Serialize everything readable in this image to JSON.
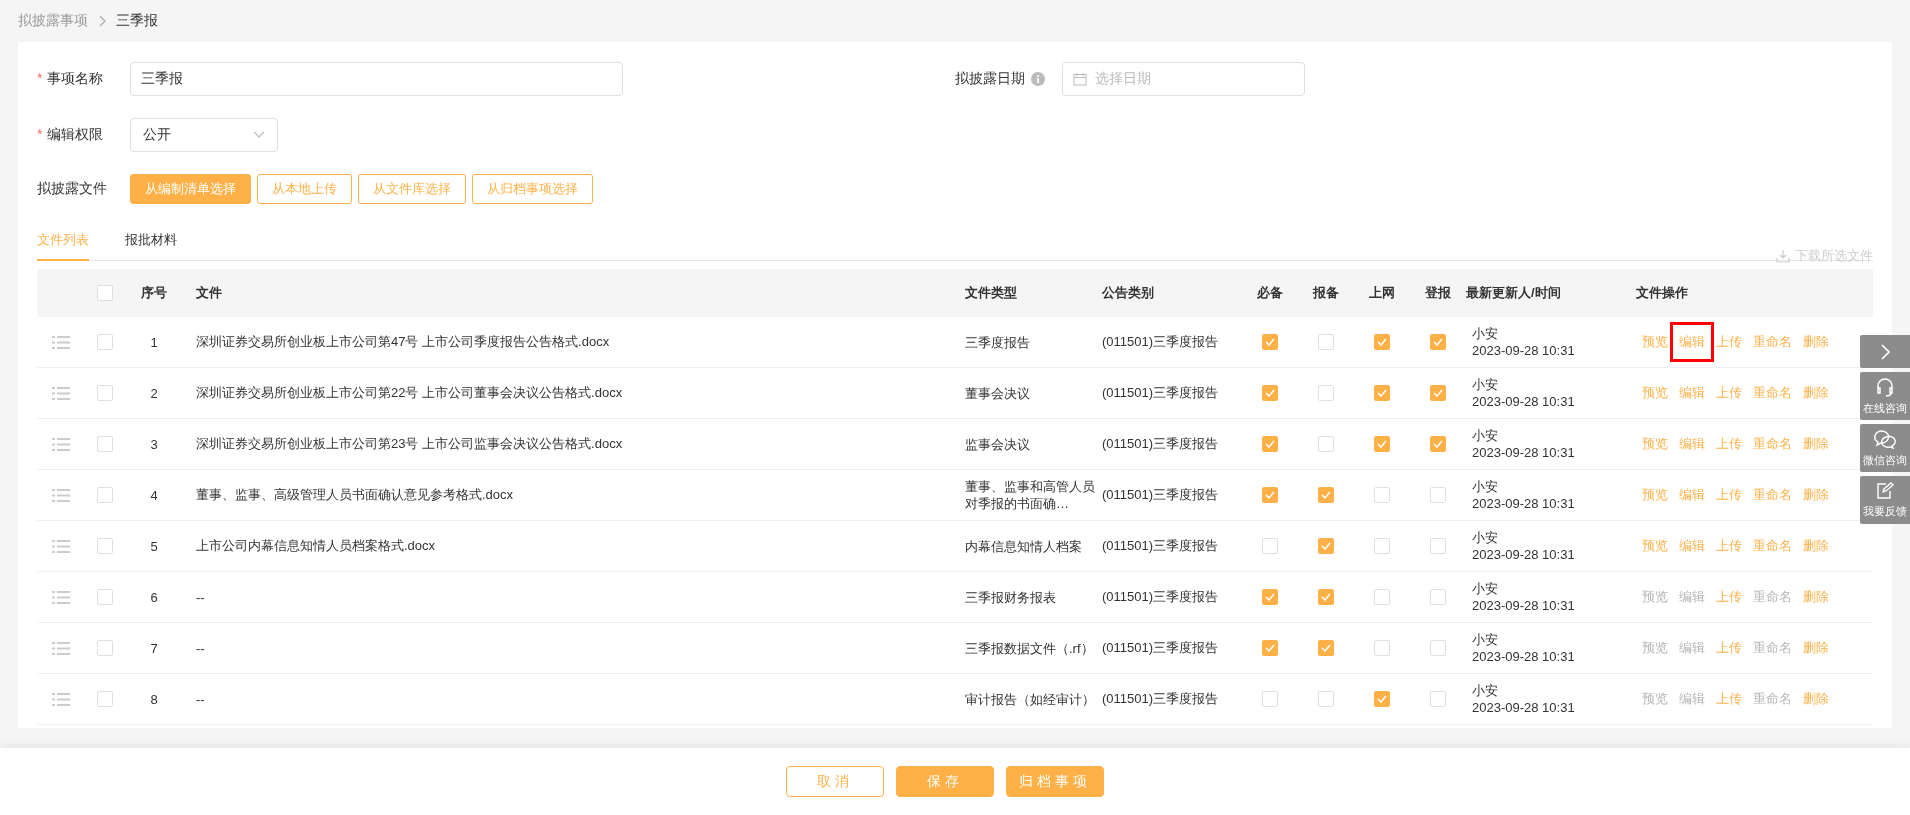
{
  "breadcrumb": [
    {
      "label": "拟披露事项"
    },
    {
      "label": "三季报"
    }
  ],
  "form": {
    "name_field": {
      "label": "事项名称",
      "required_mark": "*",
      "value": "三季报"
    },
    "date_field": {
      "label": "拟披露日期",
      "placeholder": "选择日期"
    },
    "permission_field": {
      "label": "编辑权限",
      "required_mark": "*",
      "value": "公开"
    },
    "files": {
      "label": "拟披露文件",
      "buttons": [
        {
          "label": "从编制清单选择",
          "selected": true
        },
        {
          "label": "从本地上传",
          "selected": false
        },
        {
          "label": "从文件库选择",
          "selected": false
        },
        {
          "label": "从归档事项选择",
          "selected": false
        }
      ]
    }
  },
  "tabs": [
    {
      "label": "文件列表",
      "selected": true
    },
    {
      "label": "报批材料",
      "selected": false
    }
  ],
  "download": {
    "label": "下载所选文件",
    "disabled": true
  },
  "table": {
    "select_all": false,
    "columns": [
      "序号",
      "文件",
      "文件类型",
      "公告类别",
      "必备",
      "报备",
      "上网",
      "登报",
      "最新更新人/时间",
      "文件操作"
    ],
    "rows": [
      {
        "checked": false,
        "index": "1",
        "file": "深圳证券交易所创业板上市公司第47号 上市公司季度报告公告格式.docx",
        "type": "三季度报告",
        "category": "(011501)三季度报告",
        "flags": [
          true,
          false,
          true,
          true
        ],
        "updater": "小安",
        "time": "2023-09-28 10:31",
        "actions": [
          {
            "label": "预览",
            "disabled": false,
            "highlighted": false
          },
          {
            "label": "编辑",
            "disabled": false,
            "highlighted": true
          },
          {
            "label": "上传",
            "disabled": false,
            "highlighted": false
          },
          {
            "label": "重命名",
            "disabled": false,
            "highlighted": false
          },
          {
            "label": "删除",
            "disabled": false,
            "highlighted": false
          }
        ]
      },
      {
        "checked": false,
        "index": "2",
        "file": "深圳证券交易所创业板上市公司第22号 上市公司董事会决议公告格式.docx",
        "type": "董事会决议",
        "category": "(011501)三季度报告",
        "flags": [
          true,
          false,
          true,
          true
        ],
        "updater": "小安",
        "time": "2023-09-28 10:31",
        "actions": [
          {
            "label": "预览",
            "disabled": false,
            "highlighted": false
          },
          {
            "label": "编辑",
            "disabled": false,
            "highlighted": false
          },
          {
            "label": "上传",
            "disabled": false,
            "highlighted": false
          },
          {
            "label": "重命名",
            "disabled": false,
            "highlighted": false
          },
          {
            "label": "删除",
            "disabled": false,
            "highlighted": false
          }
        ]
      },
      {
        "checked": false,
        "index": "3",
        "file": "深圳证券交易所创业板上市公司第23号 上市公司监事会决议公告格式.docx",
        "type": "监事会决议",
        "category": "(011501)三季度报告",
        "flags": [
          true,
          false,
          true,
          true
        ],
        "updater": "小安",
        "time": "2023-09-28 10:31",
        "actions": [
          {
            "label": "预览",
            "disabled": false,
            "highlighted": false
          },
          {
            "label": "编辑",
            "disabled": false,
            "highlighted": false
          },
          {
            "label": "上传",
            "disabled": false,
            "highlighted": false
          },
          {
            "label": "重命名",
            "disabled": false,
            "highlighted": false
          },
          {
            "label": "删除",
            "disabled": false,
            "highlighted": false
          }
        ]
      },
      {
        "checked": false,
        "index": "4",
        "file": "董事、监事、高级管理人员书面确认意见参考格式.docx",
        "type": "董事、监事和高管人员对季报的书面确…",
        "category": "(011501)三季度报告",
        "flags": [
          true,
          true,
          false,
          false
        ],
        "updater": "小安",
        "time": "2023-09-28 10:31",
        "actions": [
          {
            "label": "预览",
            "disabled": false,
            "highlighted": false
          },
          {
            "label": "编辑",
            "disabled": false,
            "highlighted": false
          },
          {
            "label": "上传",
            "disabled": false,
            "highlighted": false
          },
          {
            "label": "重命名",
            "disabled": false,
            "highlighted": false
          },
          {
            "label": "删除",
            "disabled": false,
            "highlighted": false
          }
        ]
      },
      {
        "checked": false,
        "index": "5",
        "file": "上市公司内幕信息知情人员档案格式.docx",
        "type": "内幕信息知情人档案",
        "category": "(011501)三季度报告",
        "flags": [
          false,
          true,
          false,
          false
        ],
        "updater": "小安",
        "time": "2023-09-28 10:31",
        "actions": [
          {
            "label": "预览",
            "disabled": false,
            "highlighted": false
          },
          {
            "label": "编辑",
            "disabled": false,
            "highlighted": false
          },
          {
            "label": "上传",
            "disabled": false,
            "highlighted": false
          },
          {
            "label": "重命名",
            "disabled": false,
            "highlighted": false
          },
          {
            "label": "删除",
            "disabled": false,
            "highlighted": false
          }
        ]
      },
      {
        "checked": false,
        "index": "6",
        "file": "--",
        "type": "三季报财务报表",
        "category": "(011501)三季度报告",
        "flags": [
          true,
          true,
          false,
          false
        ],
        "updater": "小安",
        "time": "2023-09-28 10:31",
        "actions": [
          {
            "label": "预览",
            "disabled": true,
            "highlighted": false
          },
          {
            "label": "编辑",
            "disabled": true,
            "highlighted": false
          },
          {
            "label": "上传",
            "disabled": false,
            "highlighted": false
          },
          {
            "label": "重命名",
            "disabled": true,
            "highlighted": false
          },
          {
            "label": "删除",
            "disabled": false,
            "highlighted": false
          }
        ]
      },
      {
        "checked": false,
        "index": "7",
        "file": "--",
        "type": "三季报数据文件（.rf）",
        "category": "(011501)三季度报告",
        "flags": [
          true,
          true,
          false,
          false
        ],
        "updater": "小安",
        "time": "2023-09-28 10:31",
        "actions": [
          {
            "label": "预览",
            "disabled": true,
            "highlighted": false
          },
          {
            "label": "编辑",
            "disabled": true,
            "highlighted": false
          },
          {
            "label": "上传",
            "disabled": false,
            "highlighted": false
          },
          {
            "label": "重命名",
            "disabled": true,
            "highlighted": false
          },
          {
            "label": "删除",
            "disabled": false,
            "highlighted": false
          }
        ]
      },
      {
        "checked": false,
        "index": "8",
        "file": "--",
        "type": "审计报告（如经审计）",
        "category": "(011501)三季度报告",
        "flags": [
          false,
          false,
          true,
          false
        ],
        "updater": "小安",
        "time": "2023-09-28 10:31",
        "actions": [
          {
            "label": "预览",
            "disabled": true,
            "highlighted": false
          },
          {
            "label": "编辑",
            "disabled": true,
            "highlighted": false
          },
          {
            "label": "上传",
            "disabled": false,
            "highlighted": false
          },
          {
            "label": "重命名",
            "disabled": true,
            "highlighted": false
          },
          {
            "label": "删除",
            "disabled": false,
            "highlighted": false
          }
        ]
      }
    ]
  },
  "side_tools": [
    {
      "kind": "collapse"
    },
    {
      "kind": "headset",
      "label": "在线咨询"
    },
    {
      "kind": "chat",
      "label": "微信咨询"
    },
    {
      "kind": "feedback",
      "label": "我要反馈"
    }
  ],
  "footer_buttons": [
    {
      "label": "取消",
      "kind": "outline"
    },
    {
      "label": "保存",
      "kind": "primary"
    },
    {
      "label": "归档事项",
      "kind": "primary"
    }
  ]
}
